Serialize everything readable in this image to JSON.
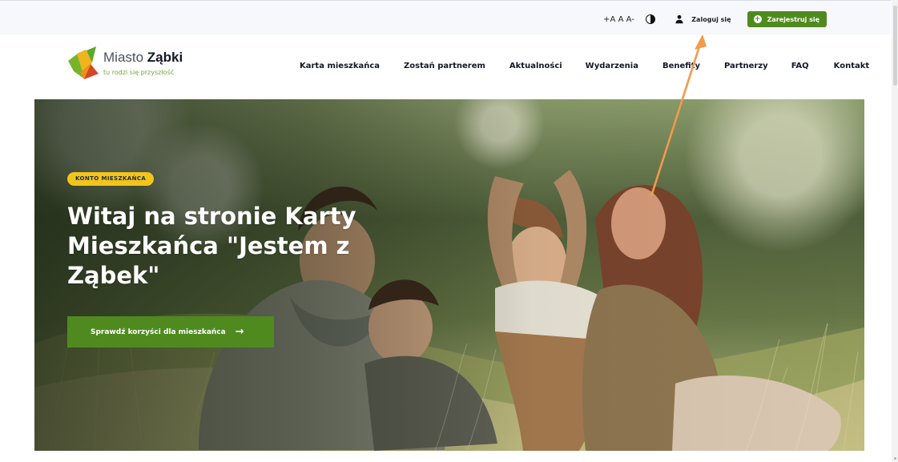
{
  "topbar": {
    "font_controls": [
      "+A",
      "A",
      "A-"
    ],
    "contrast_icon": "contrast-icon",
    "login_label": "Zaloguj się",
    "login_icon": "user-icon",
    "register_label": "Zarejestruj się",
    "register_icon": "plus-circle-icon"
  },
  "header": {
    "brand_light": "Miasto ",
    "brand_bold": "Ząbki",
    "tagline": "tu rodzi się przyszłość",
    "nav": [
      {
        "label": "Karta mieszkańca"
      },
      {
        "label": "Zostań partnerem"
      },
      {
        "label": "Aktualności"
      },
      {
        "label": "Wydarzenia"
      },
      {
        "label": "Benefity"
      },
      {
        "label": "Partnerzy"
      },
      {
        "label": "FAQ"
      },
      {
        "label": "Kontakt"
      }
    ]
  },
  "hero": {
    "badge": "KONTO MIESZKAŃCA",
    "headline": "Witaj na stronie Karty Mieszkańca \"Jestem z Ząbek\"",
    "cta_label": "Sprawdź korzyści dla mieszkańca",
    "cta_icon": "arrow-right-icon",
    "image": "family-in-meadow-photo"
  },
  "colors": {
    "accent_green": "#4f8a1f",
    "badge_yellow": "#f2c51b",
    "annotation_orange": "#f29a4a"
  }
}
